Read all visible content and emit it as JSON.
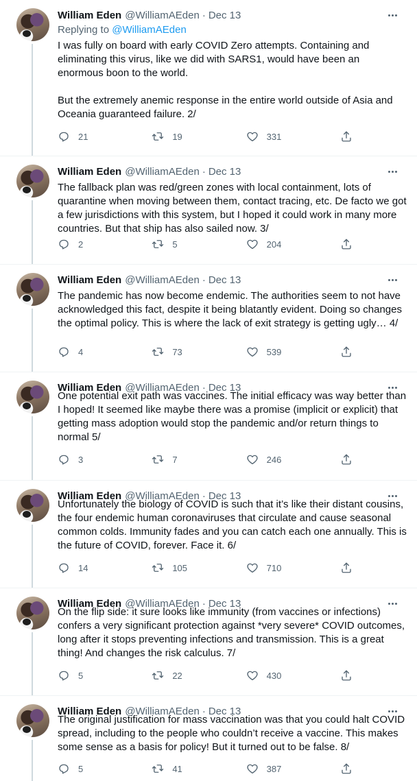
{
  "icons": {
    "reply": "reply-icon",
    "retweet": "retweet-icon",
    "like": "like-icon",
    "share": "share-icon",
    "more": "more-icon"
  },
  "colors": {
    "text": "#0f1419",
    "secondary": "#536471",
    "link": "#1d9bf0",
    "divider": "#eff3f4"
  },
  "tweets": [
    {
      "name": "William Eden",
      "handle": "@WilliamAEden",
      "date": "Dec 13",
      "replying_prefix": "Replying to",
      "replying_to": "@WilliamAEden",
      "text": "I was fully on board with early COVID Zero attempts. Containing and eliminating this virus, like we did with SARS1, would have been an enormous boon to the world.\n\nBut the extremely anemic response in the entire world outside of Asia and Oceania guaranteed failure. 2/",
      "replies": "21",
      "retweets": "19",
      "likes": "331"
    },
    {
      "name": "William Eden",
      "handle": "@WilliamAEden",
      "date": "Dec 13",
      "text": "The fallback plan was red/green zones with local containment, lots of quarantine when moving between them, contact tracing, etc. De facto we got a few jurisdictions with this system, but I hoped it could work in many more countries. But that ship has also sailed now. 3/",
      "replies": "2",
      "retweets": "5",
      "likes": "204"
    },
    {
      "name": "William Eden",
      "handle": "@WilliamAEden",
      "date": "Dec 13",
      "text": "The pandemic has now become endemic. The authorities seem to not have acknowledged this fact, despite it being blatantly evident. Doing so changes the optimal policy. This is where the lack of exit strategy is getting ugly… 4/",
      "replies": "4",
      "retweets": "73",
      "likes": "539"
    },
    {
      "name": "William Eden",
      "handle": "@WilliamAEden",
      "date": "Dec 13",
      "text": "One potential exit path was vaccines. The initial efficacy was way better than I hoped! It seemed like maybe there was a promise (implicit or explicit) that getting mass adoption would stop the pandemic and/or return things to normal 5/",
      "replies": "3",
      "retweets": "7",
      "likes": "246"
    },
    {
      "name": "William Eden",
      "handle": "@WilliamAEden",
      "date": "Dec 13",
      "text": "Unfortunately the biology of COVID is such that it’s like their distant cousins, the four endemic human coronaviruses that circulate and cause seasonal common colds. Immunity fades and you can catch each one annually. This is the future of COVID, forever. Face it. 6/",
      "replies": "14",
      "retweets": "105",
      "likes": "710"
    },
    {
      "name": "William Eden",
      "handle": "@WilliamAEden",
      "date": "Dec 13",
      "text": "On the flip side: it sure looks like immunity (from vaccines or infections) confers a very significant protection against *very severe* COVID outcomes, long after it stops preventing infections and transmission. This is a great thing! And changes the risk calculus. 7/",
      "replies": "5",
      "retweets": "22",
      "likes": "430"
    },
    {
      "name": "William Eden",
      "handle": "@WilliamAEden",
      "date": "Dec 13",
      "text": "The original justification for mass vaccination was that you could halt COVID spread, including to the people who couldn’t receive a vaccine. This makes some sense as a basis for policy! But it turned out to be false. 8/",
      "replies": "5",
      "retweets": "41",
      "likes": "387"
    }
  ]
}
